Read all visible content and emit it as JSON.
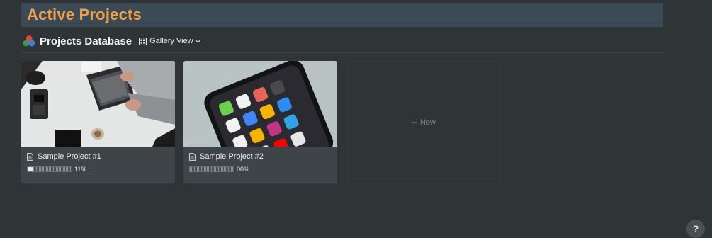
{
  "header": {
    "title": "Active Projects",
    "bg_color": "#3b4a55",
    "title_color": "#f0a04b"
  },
  "database": {
    "title": "Projects Database",
    "icon": "colored-balls-icon",
    "view_label": "Gallery View",
    "view_icon": "gallery-grid-icon"
  },
  "cards": [
    {
      "title": "Sample Project #1",
      "progress_text": "11%",
      "progress": 0.11,
      "image": "desk-laptop-photo",
      "icon": "page-icon"
    },
    {
      "title": "Sample Project #2",
      "progress_text": "00%",
      "progress": 0.0,
      "image": "smartphone-home-screen-photo",
      "icon": "page-icon"
    }
  ],
  "new_card": {
    "label": "New",
    "icon": "plus-icon"
  },
  "help": {
    "label": "?"
  }
}
